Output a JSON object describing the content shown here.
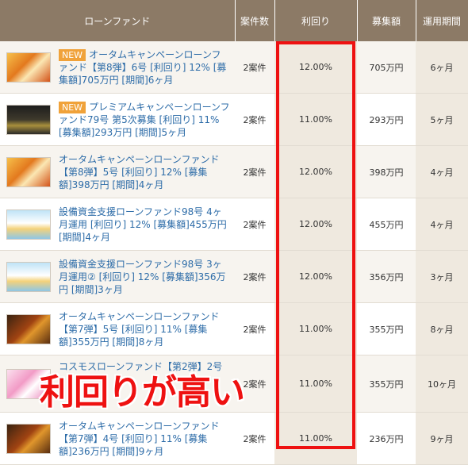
{
  "headers": {
    "fund": "ローンファンド",
    "count": "案件数",
    "yield": "利回り",
    "amount": "募集額",
    "period": "運用期間"
  },
  "new_badge": "NEW",
  "rows": [
    {
      "thumb": "autumn-campaign-thumbnail",
      "is_new": true,
      "title": "オータムキャンペーンローンファンド【第8弾】6号 [利回り] 12% [募集額]705万円 [期間]6ヶ月",
      "count": "2案件",
      "yield": "12.00%",
      "amount": "705万円",
      "period": "6ヶ月"
    },
    {
      "thumb": "premium-campaign-thumbnail",
      "is_new": true,
      "title": "プレミアムキャンペーンローンファンド79号 第5次募集 [利回り] 11% [募集額]293万円 [期間]5ヶ月",
      "count": "2案件",
      "yield": "11.00%",
      "amount": "293万円",
      "period": "5ヶ月"
    },
    {
      "thumb": "autumn-campaign-thumbnail",
      "is_new": false,
      "title": "オータムキャンペーンローンファンド【第8弾】5号 [利回り] 12% [募集額]398万円 [期間]4ヶ月",
      "count": "2案件",
      "yield": "12.00%",
      "amount": "398万円",
      "period": "4ヶ月"
    },
    {
      "thumb": "equipment-fund-thumbnail",
      "is_new": false,
      "title": "設備資金支援ローンファンド98号 4ヶ月運用 [利回り] 12% [募集額]455万円 [期間]4ヶ月",
      "count": "2案件",
      "yield": "12.00%",
      "amount": "455万円",
      "period": "4ヶ月"
    },
    {
      "thumb": "equipment-fund-thumbnail",
      "is_new": false,
      "title": "設備資金支援ローンファンド98号 3ヶ月運用② [利回り] 12% [募集額]356万円 [期間]3ヶ月",
      "count": "2案件",
      "yield": "12.00%",
      "amount": "356万円",
      "period": "3ヶ月"
    },
    {
      "thumb": "autumn-dark-thumbnail",
      "is_new": false,
      "title": "オータムキャンペーンローンファンド【第7弾】5号 [利回り] 11% [募集額]355万円 [期間]8ヶ月",
      "count": "2案件",
      "yield": "11.00%",
      "amount": "355万円",
      "period": "8ヶ月"
    },
    {
      "thumb": "cosmos-fund-thumbnail",
      "is_new": false,
      "title": "コスモスローンファンド【第2弾】2号",
      "count": "2案件",
      "yield": "11.00%",
      "amount": "355万円",
      "period": "10ヶ月"
    },
    {
      "thumb": "autumn-dark-thumbnail",
      "is_new": false,
      "title": "オータムキャンペーンローンファンド【第7弾】4号 [利回り] 11% [募集額]236万円 [期間]9ヶ月",
      "count": "2案件",
      "yield": "11.00%",
      "amount": "236万円",
      "period": "9ヶ月"
    }
  ],
  "overlay_text": "利回りが高い",
  "colors": {
    "header_bg": "#8c7a66",
    "link": "#2d6ca8",
    "highlight": "#ee1111",
    "new_badge": "#f0a23a"
  }
}
